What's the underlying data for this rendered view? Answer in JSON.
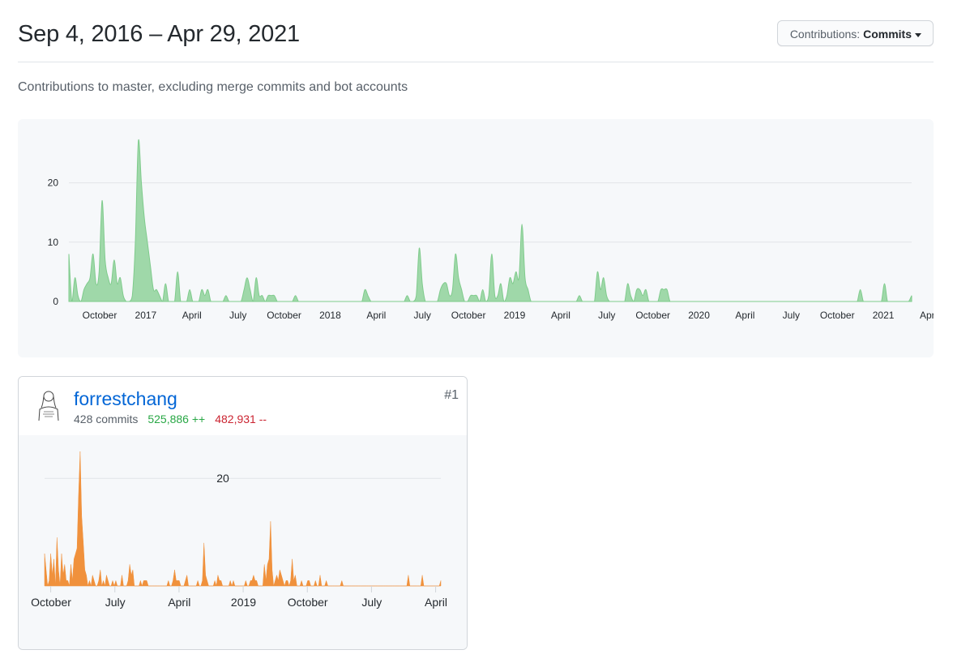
{
  "header": {
    "date_range": "Sep 4, 2016 – Apr 29, 2021",
    "contributions_label": "Contributions:",
    "contributions_value": "Commits"
  },
  "subtitle": "Contributions to master, excluding merge commits and bot accounts",
  "colors": {
    "main_area": "#9fd8a9",
    "main_line": "#7fcb8c",
    "user_area": "#f0913c",
    "link": "#0366d6",
    "additions": "#28a745",
    "deletions": "#cb2431"
  },
  "contributor": {
    "username": "forrestchang",
    "commits": "428 commits",
    "additions": "525,886 ++",
    "deletions": "482,931 --",
    "rank": "#1"
  },
  "chart_data": [
    {
      "type": "area",
      "title": "",
      "x_labels": [
        "October",
        "2017",
        "April",
        "July",
        "October",
        "2018",
        "April",
        "July",
        "October",
        "2019",
        "April",
        "July",
        "October",
        "2020",
        "April",
        "July",
        "October",
        "2021",
        "April"
      ],
      "yticks": [
        0,
        10,
        20
      ],
      "ylim": [
        0,
        28
      ],
      "x": [
        "2016-09-04",
        "2016-09-11",
        "2016-09-18",
        "2016-09-25",
        "2016-10-02",
        "2016-10-09",
        "2016-10-16",
        "2016-10-23",
        "2016-10-30",
        "2016-11-06",
        "2016-11-13",
        "2016-11-20",
        "2016-11-27",
        "2016-12-04",
        "2016-12-11",
        "2016-12-18",
        "2016-12-25",
        "2017-01-01",
        "2017-01-08",
        "2017-01-15",
        "2017-01-22",
        "2017-01-29",
        "2017-02-05",
        "2017-02-12",
        "2017-02-19",
        "2017-02-26",
        "2017-03-05",
        "2017-03-12",
        "2017-03-19",
        "2017-03-26",
        "2017-04-02",
        "2017-04-09",
        "2017-04-16",
        "2017-04-23",
        "2017-04-30",
        "2017-05-07",
        "2017-05-14",
        "2017-05-21",
        "2017-05-28",
        "2017-06-04",
        "2017-06-11",
        "2017-06-18",
        "2017-06-25",
        "2017-07-02",
        "2017-07-09",
        "2017-07-16",
        "2017-07-23",
        "2017-07-30",
        "2017-08-06",
        "2017-08-13",
        "2017-08-20",
        "2017-08-27",
        "2017-09-03",
        "2017-09-10",
        "2017-09-17",
        "2017-09-24",
        "2017-10-01",
        "2017-10-08",
        "2017-10-15",
        "2017-10-22",
        "2017-10-29",
        "2017-11-05",
        "2017-11-12",
        "2017-11-19",
        "2017-11-26",
        "2017-12-03",
        "2017-12-10",
        "2017-12-17",
        "2017-12-24",
        "2017-12-31",
        "2018-01-07",
        "2018-01-14",
        "2018-01-21",
        "2018-01-28",
        "2018-02-04",
        "2018-02-11",
        "2018-02-18",
        "2018-02-25",
        "2018-03-04",
        "2018-03-11",
        "2018-03-18",
        "2018-03-25",
        "2018-04-01",
        "2018-04-08",
        "2018-04-15",
        "2018-04-22",
        "2018-04-29",
        "2018-05-06",
        "2018-05-13",
        "2018-05-20",
        "2018-05-27",
        "2018-06-03",
        "2018-06-10",
        "2018-06-17",
        "2018-06-24",
        "2018-07-01",
        "2018-07-08",
        "2018-07-15",
        "2018-07-22",
        "2018-07-29",
        "2018-08-05",
        "2018-08-12",
        "2018-08-19",
        "2018-08-26",
        "2018-09-02",
        "2018-09-09",
        "2018-09-16",
        "2018-09-23",
        "2018-09-30",
        "2018-10-07",
        "2018-10-14",
        "2018-10-21",
        "2018-10-28",
        "2018-11-04",
        "2018-11-11",
        "2018-11-18",
        "2018-11-25",
        "2018-12-02",
        "2018-12-09",
        "2018-12-16",
        "2018-12-23",
        "2018-12-30",
        "2019-01-06",
        "2019-01-13",
        "2019-01-20",
        "2019-01-27",
        "2019-02-03",
        "2019-02-10",
        "2019-02-17",
        "2019-02-24",
        "2019-03-03",
        "2019-03-10",
        "2019-03-17",
        "2019-03-24",
        "2019-03-31",
        "2019-04-07",
        "2019-04-14",
        "2019-04-21",
        "2019-04-28",
        "2019-05-05",
        "2019-05-12",
        "2019-05-19",
        "2019-05-26",
        "2019-06-02",
        "2019-06-09",
        "2019-06-16",
        "2019-06-23",
        "2019-06-30",
        "2019-07-07",
        "2019-07-14",
        "2019-07-21",
        "2019-07-28",
        "2019-08-04",
        "2019-08-11",
        "2019-08-18",
        "2019-08-25",
        "2019-09-01",
        "2019-09-08",
        "2019-09-15",
        "2019-09-22",
        "2019-09-29",
        "2019-10-06",
        "2019-10-13",
        "2019-10-20",
        "2019-10-27",
        "2019-11-03",
        "2019-11-10",
        "2019-11-17",
        "2019-11-24",
        "2019-12-01",
        "2019-12-08",
        "2019-12-15",
        "2019-12-22",
        "2019-12-29",
        "2020-01-05",
        "2020-01-12",
        "2020-01-19",
        "2020-01-26",
        "2020-02-02",
        "2020-02-09",
        "2020-02-16",
        "2020-02-23",
        "2020-03-01",
        "2020-03-08",
        "2020-03-15",
        "2020-03-22",
        "2020-03-29",
        "2020-04-05",
        "2020-04-12",
        "2020-04-19",
        "2020-04-26",
        "2020-05-03",
        "2020-05-10",
        "2020-05-17",
        "2020-05-24",
        "2020-05-31",
        "2020-06-07",
        "2020-06-14",
        "2020-06-21",
        "2020-06-28",
        "2020-07-05",
        "2020-07-12",
        "2020-07-19",
        "2020-07-26",
        "2020-08-02",
        "2020-08-09",
        "2020-08-16",
        "2020-08-23",
        "2020-08-30",
        "2020-09-06",
        "2020-09-13",
        "2020-09-20",
        "2020-09-27",
        "2020-10-04",
        "2020-10-11",
        "2020-10-18",
        "2020-10-25",
        "2020-11-01",
        "2020-11-08",
        "2020-11-15",
        "2020-11-22",
        "2020-11-29",
        "2020-12-06",
        "2020-12-13",
        "2020-12-20",
        "2020-12-27",
        "2021-01-03",
        "2021-01-10",
        "2021-01-17",
        "2021-01-24",
        "2021-01-31",
        "2021-02-07",
        "2021-02-14",
        "2021-02-21",
        "2021-02-28",
        "2021-03-07",
        "2021-03-14",
        "2021-03-21",
        "2021-03-28",
        "2021-04-04",
        "2021-04-11",
        "2021-04-18",
        "2021-04-25"
      ],
      "y": [
        8,
        0,
        4,
        1,
        0,
        2,
        3,
        4,
        8,
        3,
        5,
        17,
        7,
        4,
        3,
        7,
        3,
        4,
        1,
        0,
        0,
        1,
        10,
        27,
        20,
        14,
        10,
        6,
        2,
        2,
        1,
        0,
        3,
        0,
        0,
        0,
        5,
        0,
        0,
        0,
        2,
        0,
        0,
        0,
        2,
        1,
        2,
        0,
        0,
        0,
        0,
        0,
        1,
        0,
        0,
        0,
        0,
        0,
        2,
        4,
        2,
        0,
        4,
        1,
        1,
        0,
        1,
        1,
        1,
        0,
        0,
        0,
        0,
        0,
        0,
        1,
        0,
        0,
        0,
        0,
        0,
        0,
        0,
        0,
        0,
        0,
        0,
        0,
        0,
        0,
        0,
        0,
        0,
        0,
        0,
        0,
        0,
        0,
        2,
        1,
        0,
        0,
        0,
        0,
        0,
        0,
        0,
        0,
        0,
        0,
        0,
        0,
        1,
        0,
        0,
        1,
        9,
        3,
        0,
        0,
        0,
        0,
        0,
        2,
        3,
        3,
        1,
        2,
        8,
        4,
        2,
        0,
        0,
        1,
        1,
        1,
        0,
        2,
        0,
        1,
        8,
        1,
        1,
        3,
        0,
        1,
        4,
        3,
        5,
        4,
        13,
        4,
        2,
        0,
        0,
        0,
        0,
        0,
        0,
        0,
        0,
        0,
        0,
        0,
        0,
        0,
        0,
        0,
        0,
        1,
        0,
        0,
        0,
        0,
        0,
        5,
        2,
        4,
        1,
        0,
        0,
        0,
        0,
        0,
        0,
        3,
        1,
        0,
        2,
        2,
        1,
        2,
        0,
        0,
        0,
        0,
        2,
        2,
        2,
        0,
        0,
        0,
        0,
        0,
        0,
        0,
        0,
        0,
        0,
        0,
        0,
        0,
        0,
        0,
        0,
        0,
        0,
        0,
        0,
        0,
        0,
        0,
        0,
        0,
        0,
        0,
        0,
        0,
        0,
        0,
        0,
        0,
        0,
        0,
        0,
        0,
        0,
        0,
        0,
        0,
        0,
        0,
        0,
        0,
        0,
        0,
        0,
        0,
        0,
        0,
        0,
        0,
        0,
        0,
        0,
        0,
        0,
        0,
        0,
        0,
        0,
        0,
        2,
        0,
        0,
        0,
        0,
        0,
        0,
        0,
        3,
        0,
        0,
        0,
        0,
        0,
        0,
        0,
        0,
        1
      ]
    },
    {
      "type": "area",
      "title": "",
      "x_labels": [
        "October",
        "July",
        "April",
        "2019",
        "October",
        "July",
        "April"
      ],
      "yticks": [
        20
      ],
      "ylim": [
        0,
        25
      ],
      "y": [
        6,
        3,
        0,
        1,
        6,
        2,
        5,
        0,
        9,
        3,
        0,
        6,
        2,
        4,
        1,
        1,
        0,
        4,
        1,
        5,
        6,
        7,
        17,
        25,
        13,
        8,
        3,
        2,
        0,
        1,
        0,
        2,
        1,
        0,
        0,
        1,
        3,
        0,
        1,
        0,
        2,
        1,
        0,
        0,
        1,
        0,
        1,
        0,
        0,
        0,
        2,
        0,
        0,
        0,
        1,
        4,
        2,
        3,
        0,
        0,
        0,
        0,
        1,
        0,
        1,
        1,
        1,
        0,
        0,
        0,
        0,
        0,
        0,
        0,
        0,
        0,
        0,
        0,
        0,
        0,
        1,
        0,
        0,
        1,
        3,
        1,
        1,
        1,
        0,
        0,
        0,
        1,
        2,
        0,
        0,
        0,
        0,
        0,
        0,
        1,
        0,
        0,
        1,
        8,
        2,
        1,
        0,
        0,
        0,
        0,
        1,
        0,
        2,
        1,
        1,
        0,
        0,
        0,
        0,
        0,
        1,
        0,
        1,
        0,
        0,
        0,
        0,
        0,
        0,
        0,
        1,
        0,
        0,
        1,
        1,
        2,
        1,
        1,
        0,
        0,
        0,
        0,
        4,
        1,
        4,
        5,
        12,
        3,
        0,
        1,
        2,
        1,
        3,
        2,
        1,
        0,
        1,
        1,
        0,
        1,
        5,
        1,
        2,
        0,
        0,
        0,
        1,
        0,
        0,
        0,
        1,
        1,
        0,
        0,
        0,
        1,
        0,
        0,
        2,
        0,
        0,
        0,
        1,
        0,
        0,
        0,
        0,
        0,
        0,
        0,
        0,
        0,
        1,
        0,
        0,
        0,
        0,
        0,
        0,
        0,
        0,
        0,
        0,
        0,
        0,
        0,
        0,
        0,
        0,
        0,
        0,
        0,
        0,
        0,
        0,
        0,
        0,
        0,
        0,
        0,
        0,
        0,
        0,
        0,
        0,
        0,
        0,
        0,
        0,
        0,
        0,
        0,
        0,
        0,
        0,
        2,
        0,
        0,
        0,
        0,
        0,
        0,
        0,
        0,
        2,
        0,
        0,
        0,
        0,
        0,
        0,
        0,
        0,
        0,
        0,
        0,
        1
      ]
    }
  ]
}
